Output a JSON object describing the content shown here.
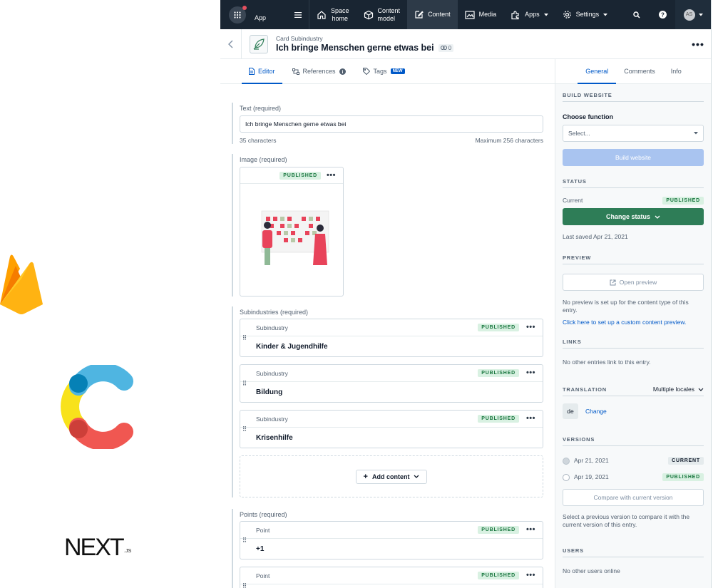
{
  "nav": {
    "app_label": "App",
    "items": [
      {
        "label_1": "Space",
        "label_2": "home"
      },
      {
        "label_1": "Content",
        "label_2": "model"
      },
      {
        "label_1": "Content"
      },
      {
        "label_1": "Media"
      },
      {
        "label_1": "Apps"
      },
      {
        "label_1": "Settings"
      }
    ],
    "avatar_initials": "AS"
  },
  "entry": {
    "content_type": "Card Subindustry",
    "title": "Ich bringe Menschen gerne etwas bei",
    "ref_count": "0"
  },
  "tabs": {
    "editor": "Editor",
    "references": "References",
    "tags": "Tags",
    "new_badge": "NEW"
  },
  "fields": {
    "text": {
      "label": "Text (required)",
      "value": "Ich bringe Menschen gerne etwas bei",
      "count": "35 characters",
      "max": "Maximum 256 characters"
    },
    "image": {
      "label": "Image (required)",
      "status": "PUBLISHED"
    },
    "subindustries": {
      "label": "Subindustries (required)",
      "items": [
        {
          "type": "Subindustry",
          "status": "PUBLISHED",
          "title": "Kinder & Jugendhilfe"
        },
        {
          "type": "Subindustry",
          "status": "PUBLISHED",
          "title": "Bildung"
        },
        {
          "type": "Subindustry",
          "status": "PUBLISHED",
          "title": "Krisenhilfe"
        }
      ],
      "add_label": "Add content"
    },
    "points": {
      "label": "Points (required)",
      "items": [
        {
          "type": "Point",
          "status": "PUBLISHED",
          "title": "+1"
        },
        {
          "type": "Point",
          "status": "PUBLISHED",
          "title": ""
        }
      ]
    }
  },
  "sidebar": {
    "tabs": {
      "general": "General",
      "comments": "Comments",
      "info": "Info"
    },
    "build": {
      "heading": "BUILD WEBSITE",
      "choose_label": "Choose function",
      "select_placeholder": "Select...",
      "button": "Build website"
    },
    "status": {
      "heading": "STATUS",
      "current_label": "Current",
      "current_value": "PUBLISHED",
      "change_button": "Change status",
      "last_saved": "Last saved Apr 21, 2021"
    },
    "preview": {
      "heading": "PREVIEW",
      "button": "Open preview",
      "note": "No preview is set up for the content type of this entry.",
      "link": "Click here to set up a custom content preview."
    },
    "links": {
      "heading": "LINKS",
      "note": "No other entries link to this entry."
    },
    "translation": {
      "heading": "TRANSLATION",
      "mode": "Multiple locales",
      "locale": "de",
      "change": "Change"
    },
    "versions": {
      "heading": "VERSIONS",
      "items": [
        {
          "date": "Apr 21, 2021",
          "badge": "CURRENT"
        },
        {
          "date": "Apr 19, 2021",
          "badge": "PUBLISHED"
        }
      ],
      "compare_button": "Compare with current version",
      "note": "Select a previous version to compare it with the current version of this entry."
    },
    "users": {
      "heading": "USERS",
      "note": "No other users online"
    }
  },
  "colors": {
    "nav_bg": "#192532",
    "accent": "#0059c8",
    "published_green": "#2e7d57"
  }
}
